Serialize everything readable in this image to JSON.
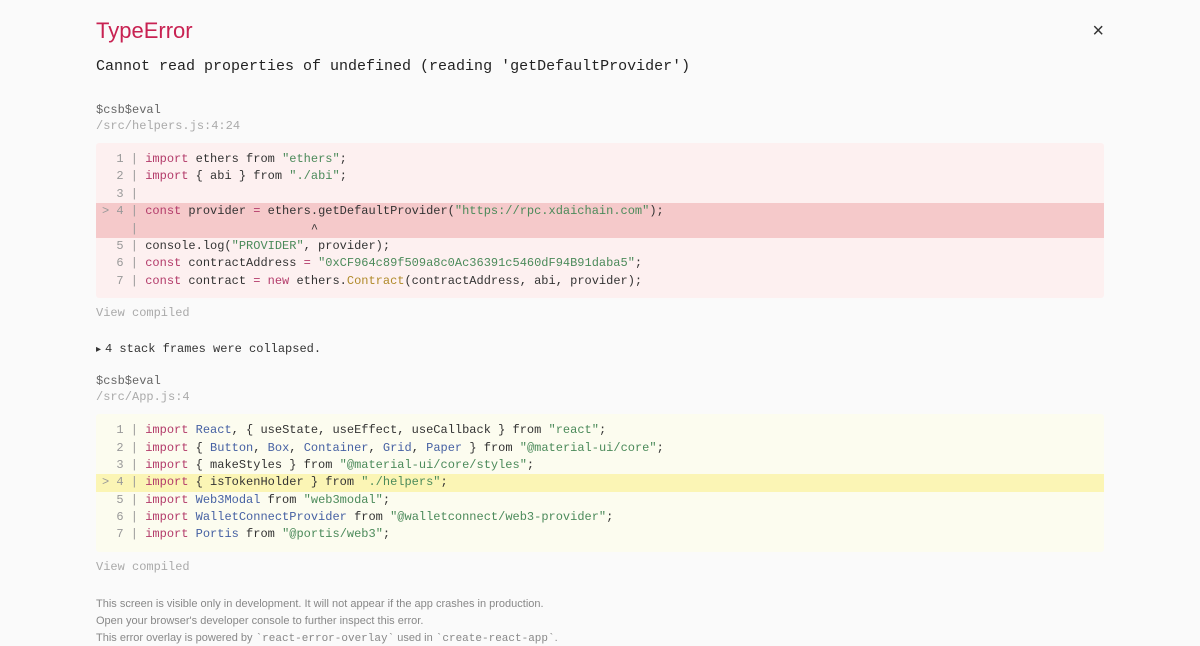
{
  "error_type": "TypeError",
  "error_message": "Cannot read properties of undefined (reading 'getDefaultProvider')",
  "close_label": "×",
  "frames": [
    {
      "fn": "$csb$eval",
      "loc": "/src/helpers.js:4:24",
      "view_compiled": "View compiled",
      "code": [
        {
          "prefix": "  1 | ",
          "tokens": [
            {
              "t": "import",
              "c": "kw-import"
            },
            {
              "t": " ethers from "
            },
            {
              "t": "\"ethers\"",
              "c": "str"
            },
            {
              "t": ";"
            }
          ]
        },
        {
          "prefix": "  2 | ",
          "tokens": [
            {
              "t": "import",
              "c": "kw-import"
            },
            {
              "t": " { abi } from "
            },
            {
              "t": "\"./abi\"",
              "c": "str"
            },
            {
              "t": ";"
            }
          ]
        },
        {
          "prefix": "  3 | ",
          "tokens": []
        },
        {
          "prefix": "> 4 | ",
          "hl": "red",
          "tokens": [
            {
              "t": "const",
              "c": "kw-import"
            },
            {
              "t": " provider "
            },
            {
              "t": "=",
              "c": "kw-import"
            },
            {
              "t": " ethers.getDefaultProvider("
            },
            {
              "t": "\"https://rpc.xdaichain.com\"",
              "c": "str"
            },
            {
              "t": ");"
            }
          ]
        },
        {
          "prefix": "    | ",
          "hl": "red",
          "tokens": [
            {
              "t": "                       ^"
            }
          ]
        },
        {
          "prefix": "  5 | ",
          "tokens": [
            {
              "t": "console.log("
            },
            {
              "t": "\"PROVIDER\"",
              "c": "str"
            },
            {
              "t": ", provider);"
            }
          ]
        },
        {
          "prefix": "  6 | ",
          "tokens": [
            {
              "t": "const",
              "c": "kw-import"
            },
            {
              "t": " contractAddress "
            },
            {
              "t": "=",
              "c": "kw-import"
            },
            {
              "t": " "
            },
            {
              "t": "\"0xCF964c89f509a8c0Ac36391c5460dF94B91daba5\"",
              "c": "str"
            },
            {
              "t": ";"
            }
          ]
        },
        {
          "prefix": "  7 | ",
          "tokens": [
            {
              "t": "const",
              "c": "kw-import"
            },
            {
              "t": " contract "
            },
            {
              "t": "=",
              "c": "kw-import"
            },
            {
              "t": " "
            },
            {
              "t": "new",
              "c": "kw-import"
            },
            {
              "t": " ethers."
            },
            {
              "t": "Contract",
              "c": "cls"
            },
            {
              "t": "(contractAddress, abi, provider);"
            }
          ]
        }
      ]
    },
    {
      "fn": "$csb$eval",
      "loc": "/src/App.js:4",
      "view_compiled": "View compiled",
      "code": [
        {
          "prefix": "  1 | ",
          "tokens": [
            {
              "t": "import",
              "c": "kw-import"
            },
            {
              "t": " "
            },
            {
              "t": "React",
              "c": "id"
            },
            {
              "t": ", { useState, useEffect, useCallback } from "
            },
            {
              "t": "\"react\"",
              "c": "str"
            },
            {
              "t": ";"
            }
          ]
        },
        {
          "prefix": "  2 | ",
          "tokens": [
            {
              "t": "import",
              "c": "kw-import"
            },
            {
              "t": " { "
            },
            {
              "t": "Button",
              "c": "id"
            },
            {
              "t": ", "
            },
            {
              "t": "Box",
              "c": "id"
            },
            {
              "t": ", "
            },
            {
              "t": "Container",
              "c": "id"
            },
            {
              "t": ", "
            },
            {
              "t": "Grid",
              "c": "id"
            },
            {
              "t": ", "
            },
            {
              "t": "Paper",
              "c": "id"
            },
            {
              "t": " } from "
            },
            {
              "t": "\"@material-ui/core\"",
              "c": "str"
            },
            {
              "t": ";"
            }
          ]
        },
        {
          "prefix": "  3 | ",
          "tokens": [
            {
              "t": "import",
              "c": "kw-import"
            },
            {
              "t": " { makeStyles } from "
            },
            {
              "t": "\"@material-ui/core/styles\"",
              "c": "str"
            },
            {
              "t": ";"
            }
          ]
        },
        {
          "prefix": "> 4 | ",
          "hl": "yellow",
          "tokens": [
            {
              "t": "import",
              "c": "kw-import"
            },
            {
              "t": " { isTokenHolder } from "
            },
            {
              "t": "\"./helpers\"",
              "c": "str"
            },
            {
              "t": ";"
            }
          ]
        },
        {
          "prefix": "  5 | ",
          "tokens": [
            {
              "t": "import",
              "c": "kw-import"
            },
            {
              "t": " "
            },
            {
              "t": "Web3Modal",
              "c": "id"
            },
            {
              "t": " from "
            },
            {
              "t": "\"web3modal\"",
              "c": "str"
            },
            {
              "t": ";"
            }
          ]
        },
        {
          "prefix": "  6 | ",
          "tokens": [
            {
              "t": "import",
              "c": "kw-import"
            },
            {
              "t": " "
            },
            {
              "t": "WalletConnectProvider",
              "c": "id"
            },
            {
              "t": " from "
            },
            {
              "t": "\"@walletconnect/web3-provider\"",
              "c": "str"
            },
            {
              "t": ";"
            }
          ]
        },
        {
          "prefix": "  7 | ",
          "tokens": [
            {
              "t": "import",
              "c": "kw-import"
            },
            {
              "t": " "
            },
            {
              "t": "Portis",
              "c": "id"
            },
            {
              "t": " from "
            },
            {
              "t": "\"@portis/web3\"",
              "c": "str"
            },
            {
              "t": ";"
            }
          ]
        }
      ]
    }
  ],
  "collapsed_text": "4 stack frames were collapsed.",
  "footer": {
    "l1": "This screen is visible only in development. It will not appear if the app crashes in production.",
    "l2": "Open your browser's developer console to further inspect this error.",
    "l3_a": "This error overlay is powered by ",
    "l3_b": "`react-error-overlay`",
    "l3_c": " used in ",
    "l3_d": "`create-react-app`",
    "l3_e": "."
  }
}
